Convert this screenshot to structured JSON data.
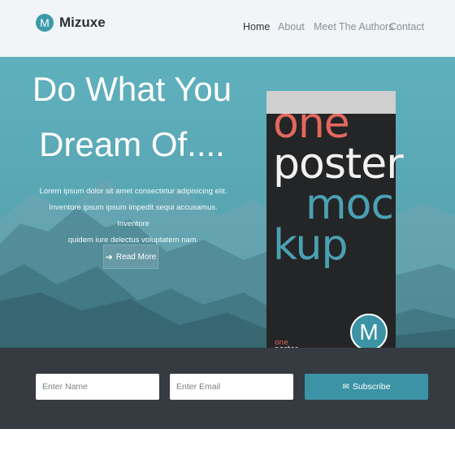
{
  "brand": {
    "logo_letter": "M",
    "name": "Mizuxe"
  },
  "nav": {
    "items": [
      "Home",
      "About",
      "Meet The Authors",
      "Contact"
    ],
    "active": "Home"
  },
  "hero": {
    "title_line1": "Do What You",
    "title_line2": "Dream Of....",
    "description_lines": [
      "Lorem ipsum dolor sit amet consectetur adipisicing elit.",
      "Inventore ipsum ipsum impedit sequi accusamus. Inventore",
      "quidem iure delectus voluptatem nam."
    ],
    "read_more_label": "Read More",
    "read_more_icon": "arrow-right-icon"
  },
  "poster": {
    "words": [
      "one",
      "poster",
      "moc",
      "kup"
    ],
    "logo_letter": "M"
  },
  "subscribe": {
    "name_placeholder": "Enter Name",
    "email_placeholder": "Enter Email",
    "button_label": "Subscribe",
    "button_icon": "envelope-icon"
  },
  "colors": {
    "accent": "#3b93a5",
    "poster_coral": "#e4675e",
    "dark_bar": "#363b42",
    "poster_bg": "#242526"
  }
}
